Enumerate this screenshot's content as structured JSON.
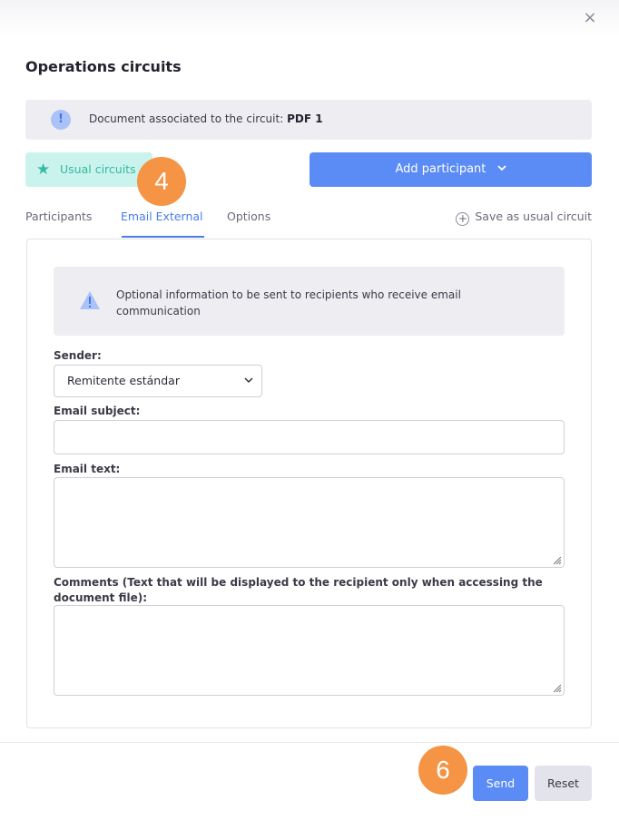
{
  "dialog": {
    "title": "Operations circuits",
    "close_icon": "×"
  },
  "document_banner": {
    "label": "Document associated to the circuit: ",
    "document_name": "PDF 1",
    "icon": "!"
  },
  "toolbar": {
    "usual_circuits_label": "Usual circuits",
    "add_participant_label": "Add participant",
    "add_participant_chevron": "⌄"
  },
  "badges": {
    "step_a": "4",
    "step_b": "6"
  },
  "tabs": [
    {
      "label": "Participants",
      "active": false
    },
    {
      "label": "Email External",
      "active": true
    },
    {
      "label": "Options",
      "active": false
    }
  ],
  "save_usual_circuit_label": "Save as usual circuit",
  "email_form": {
    "notice": "Optional information to be sent to recipients who receive email communication",
    "sender_label": "Sender:",
    "sender_value": "Remitente estándar",
    "subject_label": "Email subject:",
    "subject_value": "",
    "text_label": "Email text:",
    "text_value": "",
    "comments_label": "Comments (Text that will be displayed to the recipient only when accessing the document file):",
    "comments_value": ""
  },
  "footer": {
    "send_label": "Send",
    "reset_label": "Reset"
  },
  "colors": {
    "accent": "#5b8cf5",
    "teal": "#35b9a3",
    "badge": "#f49444"
  }
}
